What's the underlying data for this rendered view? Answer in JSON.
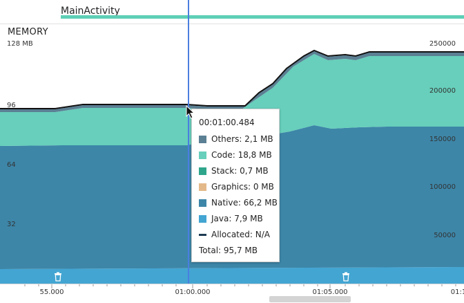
{
  "activity": {
    "label": "MainActivity"
  },
  "memory": {
    "title": "MEMORY",
    "left_axis": [
      "128 MB",
      "96",
      "64",
      "32"
    ],
    "right_axis": [
      "250000",
      "200000",
      "150000",
      "100000",
      "50000"
    ]
  },
  "timeline": {
    "ticks": [
      "55.000",
      "01:00.000",
      "01:05.000",
      "01:1"
    ]
  },
  "tooltip": {
    "time": "00:01:00.484",
    "rows": [
      {
        "label": "Others: 2,1 MB",
        "color": "#5b7f93"
      },
      {
        "label": "Code: 18,8 MB",
        "color": "#67cfbb"
      },
      {
        "label": "Stack: 0,7 MB",
        "color": "#2fa58b"
      },
      {
        "label": "Graphics: 0 MB",
        "color": "#e4b98a"
      },
      {
        "label": "Native: 66,2 MB",
        "color": "#3d86a8"
      },
      {
        "label": "Java: 7,9 MB",
        "color": "#43a5d2"
      },
      {
        "label": "Allocated: N/A",
        "color": "#1f3b53",
        "dashed": true
      }
    ],
    "total": "Total: 95,7 MB"
  },
  "colors": {
    "java": "#43a5d2",
    "native": "#3d86a8",
    "code": "#67cfbb",
    "others": "#5b7f93",
    "outline": "#111111",
    "cursor": "#4a7fe0"
  },
  "icons": {
    "gc": "trash-can-icon",
    "mouse": "mouse-pointer-icon"
  }
}
